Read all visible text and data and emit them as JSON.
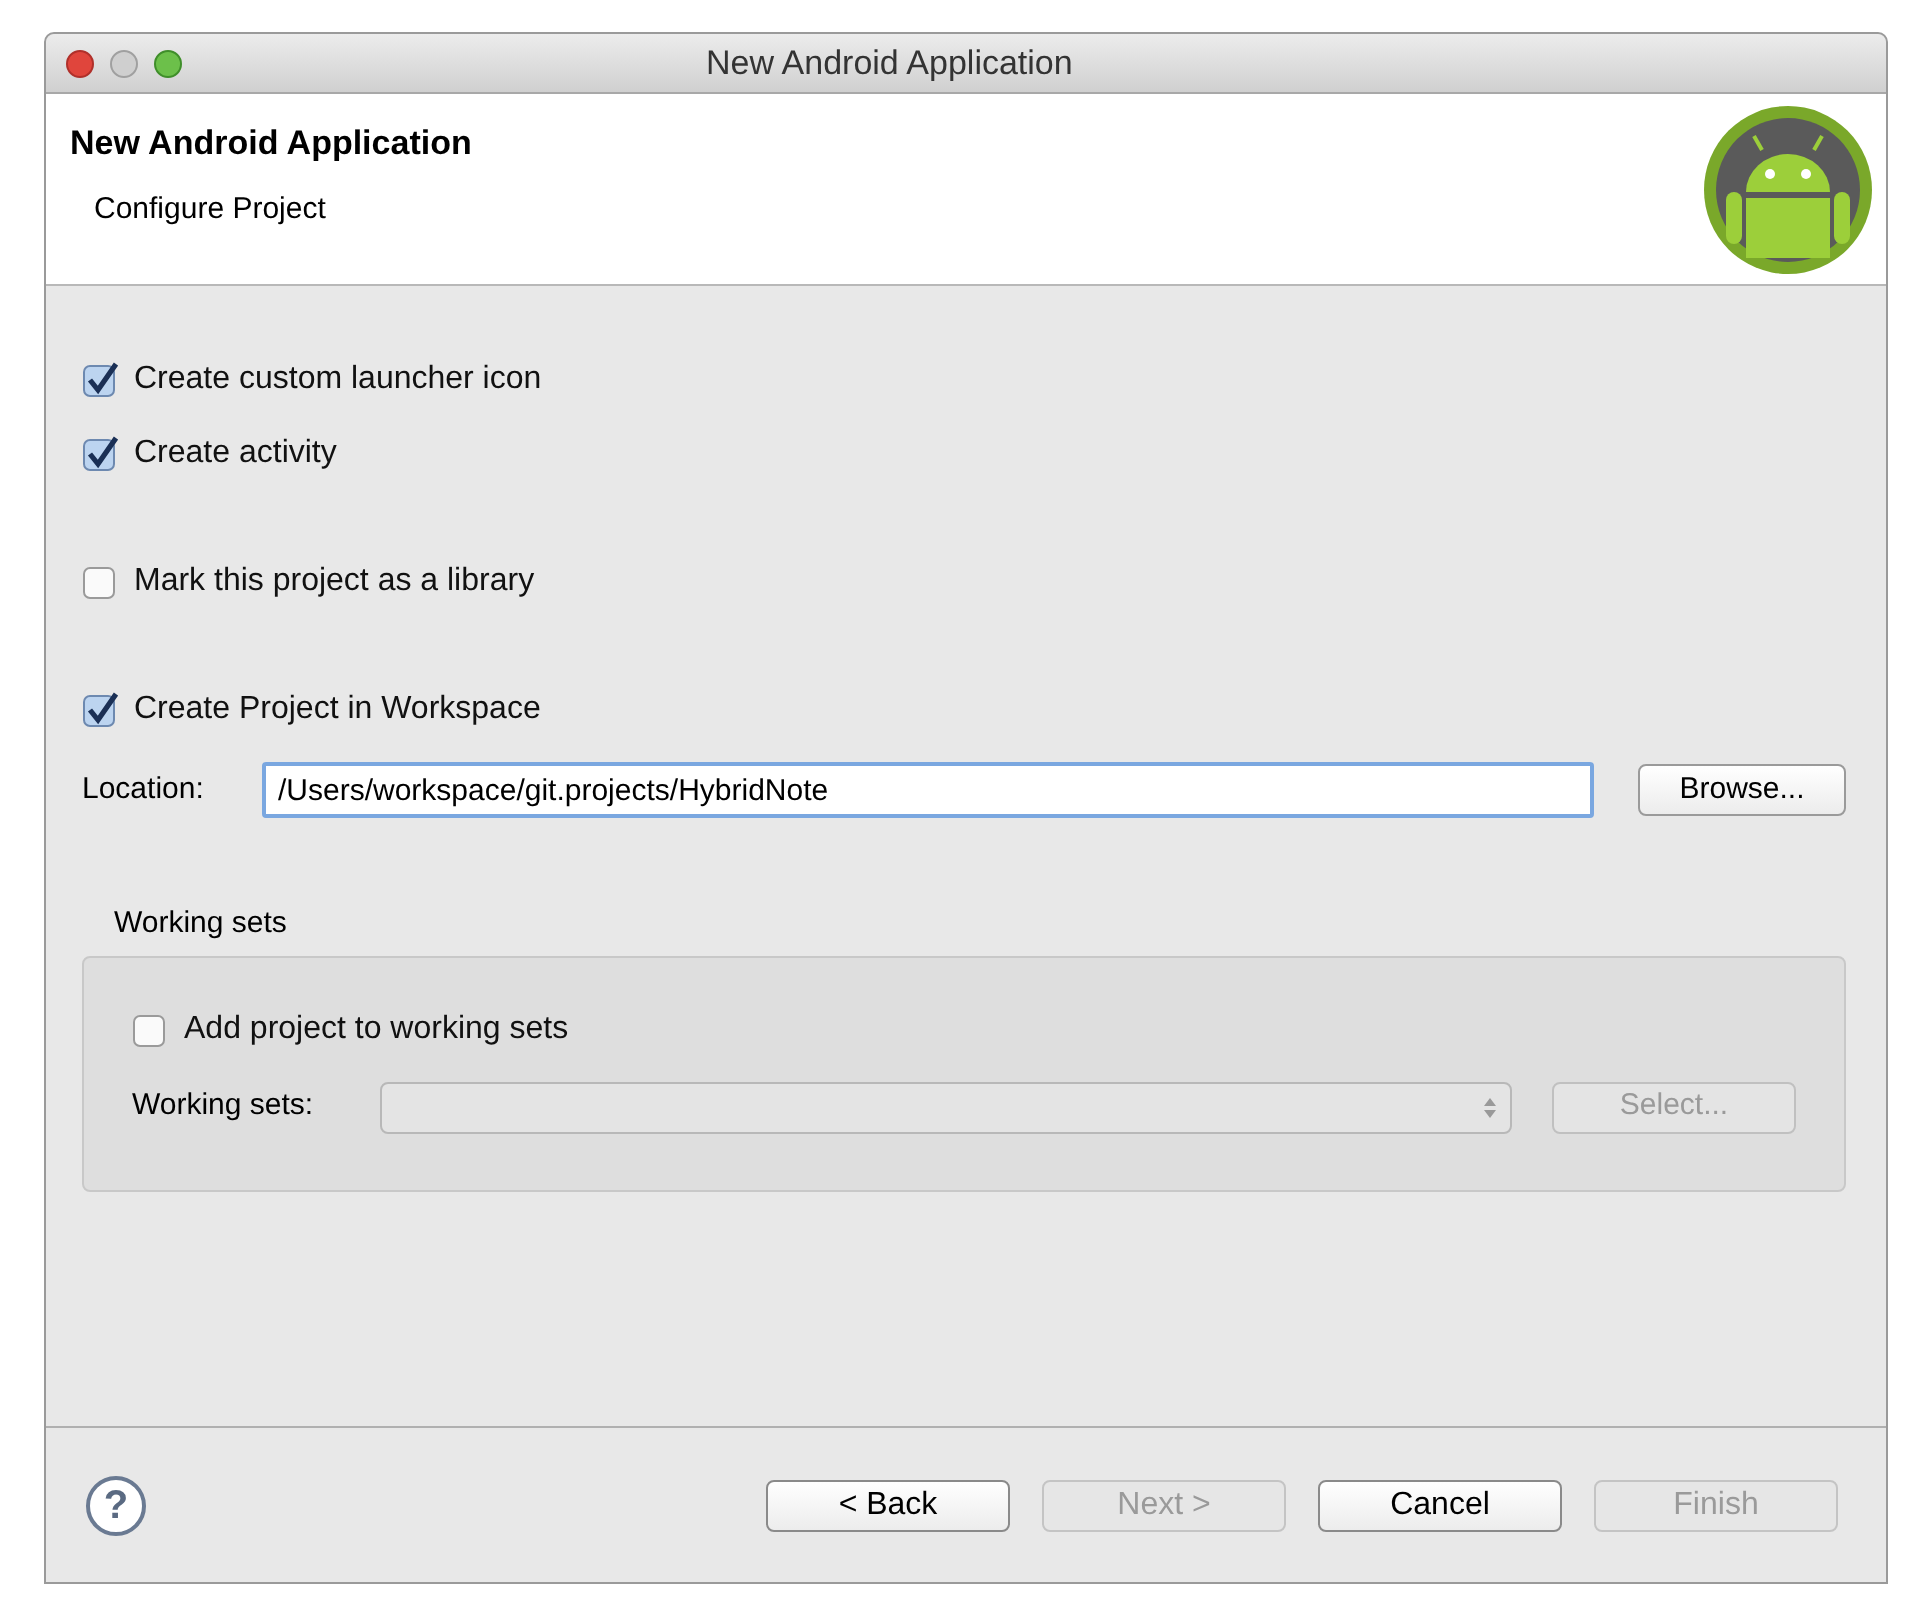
{
  "window": {
    "title": "New Android Application"
  },
  "header": {
    "title": "New Android Application",
    "subtitle": "Configure Project"
  },
  "options": [
    {
      "label": "Create custom launcher icon",
      "checked": true
    },
    {
      "label": "Create activity",
      "checked": true
    },
    {
      "label": "Mark this project as a library",
      "checked": false
    },
    {
      "label": "Create Project in Workspace",
      "checked": true
    }
  ],
  "location": {
    "label": "Location:",
    "value": "/Users/workspace/git.projects/HybridNote",
    "browse": "Browse..."
  },
  "working_sets": {
    "title": "Working sets",
    "checkbox": {
      "label": "Add project to working sets",
      "checked": false
    },
    "field_label": "Working sets:",
    "select_disabled": true,
    "button": {
      "label": "Select...",
      "disabled": true
    }
  },
  "help": "?",
  "buttons": [
    {
      "label": "< Back",
      "disabled": false
    },
    {
      "label": "Next >",
      "disabled": true
    },
    {
      "label": "Cancel",
      "disabled": false
    },
    {
      "label": "Finish",
      "disabled": true
    }
  ]
}
